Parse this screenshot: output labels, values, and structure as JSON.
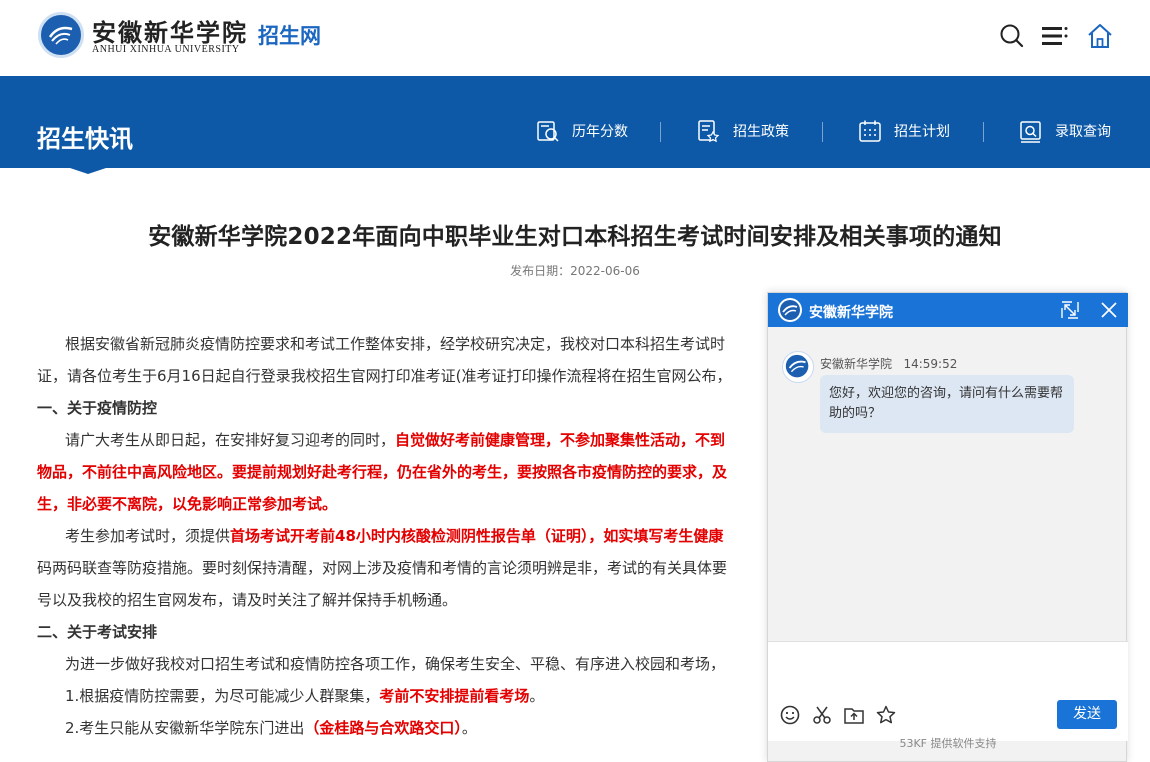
{
  "header": {
    "brand_cn": "安徽新华学院",
    "brand_en": "ANHUI XINHUA UNIVERSITY",
    "brand_sub": "招生网",
    "icons": [
      "search-icon",
      "menu-icon",
      "home-icon"
    ]
  },
  "banner": {
    "title": "招生快讯",
    "nav": [
      {
        "label": "历年分数",
        "icon": "score-icon"
      },
      {
        "label": "招生政策",
        "icon": "policy-icon"
      },
      {
        "label": "招生计划",
        "icon": "calendar-icon"
      },
      {
        "label": "录取查询",
        "icon": "query-icon"
      }
    ]
  },
  "article": {
    "title": "安徽新华学院2022年面向中职毕业生对口本科招生考试时间安排及相关事项的通知",
    "date": "发布日期：2022-06-06",
    "lines": {
      "p1a": "根据安徽省新冠肺炎疫情防控要求和考试工作整体安排，经学校研究决定，我校对口本科招生考试时",
      "p1b": "证，请各位考生于6月16日起自行登录我校招生官网打印准考证(准考证打印操作流程将在招生官网公布，",
      "h1": "一、关于疫情防控",
      "p2a_normal": "请广大考生从即日起，在安排好复习迎考的同时，",
      "p2a_red": "自觉做好考前健康管理，不参加聚集性活动，不到",
      "p2b": "物品，不前往中高风险地区。要提前规划好赴考行程，仍在省外的考生，要按照各市疫情防控的要求，及",
      "p2c": "生，非必要不离院，以免影响正常参加考试。",
      "p3a_normal": "考生参加考试时，须提供",
      "p3a_red": "首场考试开考前48小时内核酸检测阴性报告单（证明），如实填写考生健康",
      "p3b": "码两码联查等防疫措施。要时刻保持清醒，对网上涉及疫情和考情的言论须明辨是非，考试的有关具体要",
      "p3c": "号以及我校的招生官网发布，请及时关注了解并保持手机畅通。",
      "h2": "二、关于考试安排",
      "p4": "为进一步做好我校对口招生考试和疫情防控各项工作，确保考生安全、平稳、有序进入校园和考场，",
      "p5_normal": "1.根据疫情防控需要，为尽可能减少人群聚集，",
      "p5_red": "考前不安排提前看考场",
      "p5_tail": "。",
      "p6_normal": "2.考生只能从安徽新华学院东门进出",
      "p6_red": "（金桂路与合欢路交口）",
      "p6_tail": "。"
    }
  },
  "chat": {
    "title": "安徽新华学院",
    "sender": "安徽新华学院",
    "time": "14:59:52",
    "message": "您好，欢迎您的咨询，请问有什么需要帮助的吗？",
    "send_label": "发送",
    "powered": "53KF 提供软件支持",
    "tools": [
      "emoji-icon",
      "scissors-icon",
      "upload-icon",
      "star-icon"
    ]
  },
  "colors": {
    "banner_blue": "#0d59a8",
    "chat_blue": "#1a73d6",
    "highlight_red": "#e40000",
    "brand_blue": "#1a66c0"
  }
}
